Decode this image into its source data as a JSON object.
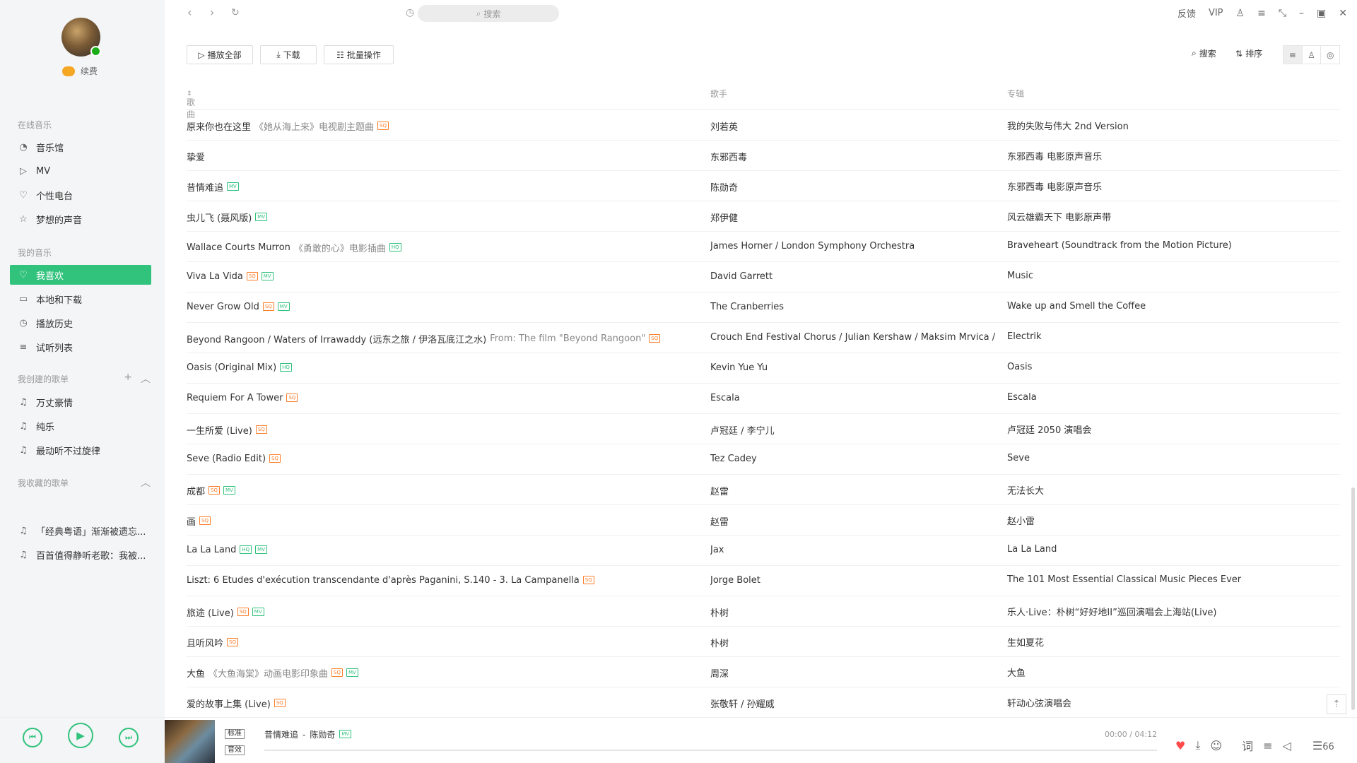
{
  "user": {
    "name": "续费"
  },
  "sidebar": {
    "online_title": "在线音乐",
    "online_items": [
      {
        "label": "音乐馆",
        "icon": "music-hall-icon",
        "glyph": "◔"
      },
      {
        "label": "MV",
        "icon": "mv-icon",
        "glyph": "▷"
      },
      {
        "label": "个性电台",
        "icon": "radio-icon",
        "glyph": "♡"
      },
      {
        "label": "梦想的声音",
        "icon": "star-icon",
        "glyph": "☆"
      }
    ],
    "my_title": "我的音乐",
    "my_items": [
      {
        "label": "我喜欢",
        "icon": "heart-icon",
        "glyph": "♡",
        "active": true
      },
      {
        "label": "本地和下载",
        "icon": "monitor-icon",
        "glyph": "▭"
      },
      {
        "label": "播放历史",
        "icon": "clock-icon",
        "glyph": "◷"
      },
      {
        "label": "试听列表",
        "icon": "playlist-icon",
        "glyph": "≡"
      }
    ],
    "created_title": "我创建的歌单",
    "created_items": [
      {
        "label": "万丈豪情",
        "icon": "note-icon",
        "glyph": "♫"
      },
      {
        "label": "纯乐",
        "icon": "note-icon",
        "glyph": "♫"
      },
      {
        "label": "最动听不过旋律",
        "icon": "note-icon",
        "glyph": "♫"
      }
    ],
    "collected_title": "我收藏的歌单",
    "collected_items": [
      {
        "label": "「经典粤语」渐渐被遗忘...",
        "icon": "note-icon",
        "glyph": "♫"
      },
      {
        "label": "百首值得静听老歌：我被...",
        "icon": "note-icon",
        "glyph": "♫"
      }
    ]
  },
  "topbar": {
    "search_placeholder": "搜索",
    "feedback": "反馈",
    "vip": "VIP"
  },
  "actions": {
    "play_all": "播放全部",
    "download": "下载",
    "batch": "批量操作",
    "search": "搜索",
    "sort": "排序"
  },
  "table": {
    "col_song": "歌曲",
    "col_artist": "歌手",
    "col_album": "专辑",
    "rows": [
      {
        "title": "原来你也在这里",
        "note": "《她从海上来》电视剧主题曲",
        "tags": [
          "SQ"
        ],
        "artist": "刘若英",
        "album": "我的失败与伟大 2nd Version"
      },
      {
        "title": "挚爱",
        "note": "",
        "tags": [],
        "artist": "东邪西毒",
        "album": "东邪西毒 电影原声音乐"
      },
      {
        "title": "昔情难追",
        "note": "",
        "tags": [
          "MV"
        ],
        "artist": "陈勋奇",
        "album": "东邪西毒 电影原声音乐"
      },
      {
        "title": "虫儿飞 (聂风版)",
        "note": "",
        "tags": [
          "MV"
        ],
        "artist": "郑伊健",
        "album": "风云雄霸天下 电影原声带"
      },
      {
        "title": "Wallace Courts Murron",
        "note": "《勇敢的心》电影插曲",
        "tags": [
          "HQ"
        ],
        "artist": "James Horner / London Symphony Orchestra",
        "album": "Braveheart (Soundtrack from the Motion Picture)"
      },
      {
        "title": "Viva La Vida",
        "note": "",
        "tags": [
          "SQ",
          "MV"
        ],
        "artist": "David Garrett",
        "album": "Music"
      },
      {
        "title": "Never Grow Old",
        "note": "",
        "tags": [
          "SQ",
          "MV"
        ],
        "artist": "The Cranberries",
        "album": "Wake up and Smell the Coffee"
      },
      {
        "title": "Beyond Rangoon / Waters of Irrawaddy (远东之旅 / 伊洛瓦底江之水)",
        "note": "From: The film \"Beyond Rangoon\"",
        "tags": [
          "SQ"
        ],
        "artist": "Crouch End Festival Chorus / Julian Kershaw / Maksim Mrvica / F",
        "album": "Electrik"
      },
      {
        "title": "Oasis (Original Mix)",
        "note": "",
        "tags": [
          "HQ"
        ],
        "artist": "Kevin Yue Yu",
        "album": "Oasis"
      },
      {
        "title": "Requiem For A Tower",
        "note": "",
        "tags": [
          "SQ"
        ],
        "artist": "Escala",
        "album": "Escala"
      },
      {
        "title": "一生所爱 (Live)",
        "note": "",
        "tags": [
          "SQ"
        ],
        "artist": "卢冠廷 / 李宁儿",
        "album": "卢冠廷 2050 演唱会"
      },
      {
        "title": "Seve (Radio Edit)",
        "note": "",
        "tags": [
          "SQ"
        ],
        "artist": "Tez Cadey",
        "album": "Seve"
      },
      {
        "title": "成都",
        "note": "",
        "tags": [
          "SQ",
          "MV"
        ],
        "artist": "赵雷",
        "album": "无法长大"
      },
      {
        "title": "画",
        "note": "",
        "tags": [
          "SQ"
        ],
        "artist": "赵雷",
        "album": "赵小雷"
      },
      {
        "title": "La La Land",
        "note": "",
        "tags": [
          "HQ",
          "MV"
        ],
        "artist": "Jax",
        "album": "La La Land"
      },
      {
        "title": "Liszt: 6 Etudes d'exécution transcendante d'après Paganini, S.140 - 3. La Campanella",
        "note": "",
        "tags": [
          "SQ"
        ],
        "artist": "Jorge Bolet",
        "album": "The 101 Most Essential Classical Music Pieces Ever"
      },
      {
        "title": "旅途 (Live)",
        "note": "",
        "tags": [
          "SQ",
          "MV"
        ],
        "artist": "朴树",
        "album": "乐人·Live：朴树“好好地II”巡回演唱会上海站(Live)"
      },
      {
        "title": "且听风吟",
        "note": "",
        "tags": [
          "SQ"
        ],
        "artist": "朴树",
        "album": "生如夏花"
      },
      {
        "title": "大鱼",
        "note": "《大鱼海棠》动画电影印象曲",
        "tags": [
          "SQ",
          "MV"
        ],
        "artist": "周深",
        "album": "大鱼"
      },
      {
        "title": "爱的故事上集 (Live)",
        "note": "",
        "tags": [
          "SQ"
        ],
        "artist": "张敬轩 / 孙耀威",
        "album": "轩动心弦演唱会"
      }
    ]
  },
  "player": {
    "quality": "标准",
    "effect": "音效",
    "now_title": "昔情难追",
    "separator": " - ",
    "now_artist": "陈勋奇",
    "now_tag": "MV",
    "time": "00:00 / 04:12",
    "progress": 0,
    "lyrics": "词",
    "queue_count": "66"
  },
  "colors": {
    "accent": "#31c27c",
    "sq": "#ff7e29",
    "heart": "#ff4a4a"
  }
}
